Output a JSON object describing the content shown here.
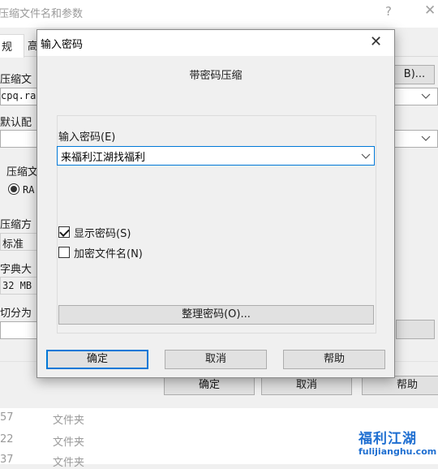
{
  "parent": {
    "title": "压缩文件名和参数",
    "help_glyph": "?",
    "close_glyph": "✕",
    "tabs": {
      "general": "规",
      "advanced": "高"
    },
    "archive_name_label": "压缩文",
    "browse_button": "B)...",
    "archive_name_value": "cpq.ra",
    "default_profile_label": "默认配",
    "format_label": "压缩文",
    "format_option": "RA",
    "method_label": "压缩方",
    "method_value": "标准",
    "dict_label": "字典大",
    "dict_value": "32 MB",
    "split_label": "切分为",
    "buttons": {
      "ok": "确定",
      "cancel": "取消",
      "help": "帮助"
    },
    "list_rows": [
      {
        "num": "57",
        "type": "文件夹"
      },
      {
        "num": "22",
        "type": "文件夹"
      },
      {
        "num": "37",
        "type": "文件夹"
      }
    ]
  },
  "dialog": {
    "title": "输入密码",
    "close_glyph": "✕",
    "heading": "带密码压缩",
    "password_label": "输入密码(E)",
    "password_value": "来福利江湖找福利",
    "show_password_label": "显示密码(S)",
    "show_password_checked": true,
    "encrypt_names_label": "加密文件名(N)",
    "encrypt_names_checked": false,
    "organize_button": "整理密码(O)...",
    "ok_button": "确定",
    "cancel_button": "取消",
    "help_button": "帮助"
  },
  "watermark": {
    "brand_cn": "福利江湖",
    "domain": "fulijianghu.com"
  },
  "colors": {
    "accent": "#0078d7",
    "watermark_blue": "#1f6fd1",
    "watermark_red": "#e23b3b"
  }
}
